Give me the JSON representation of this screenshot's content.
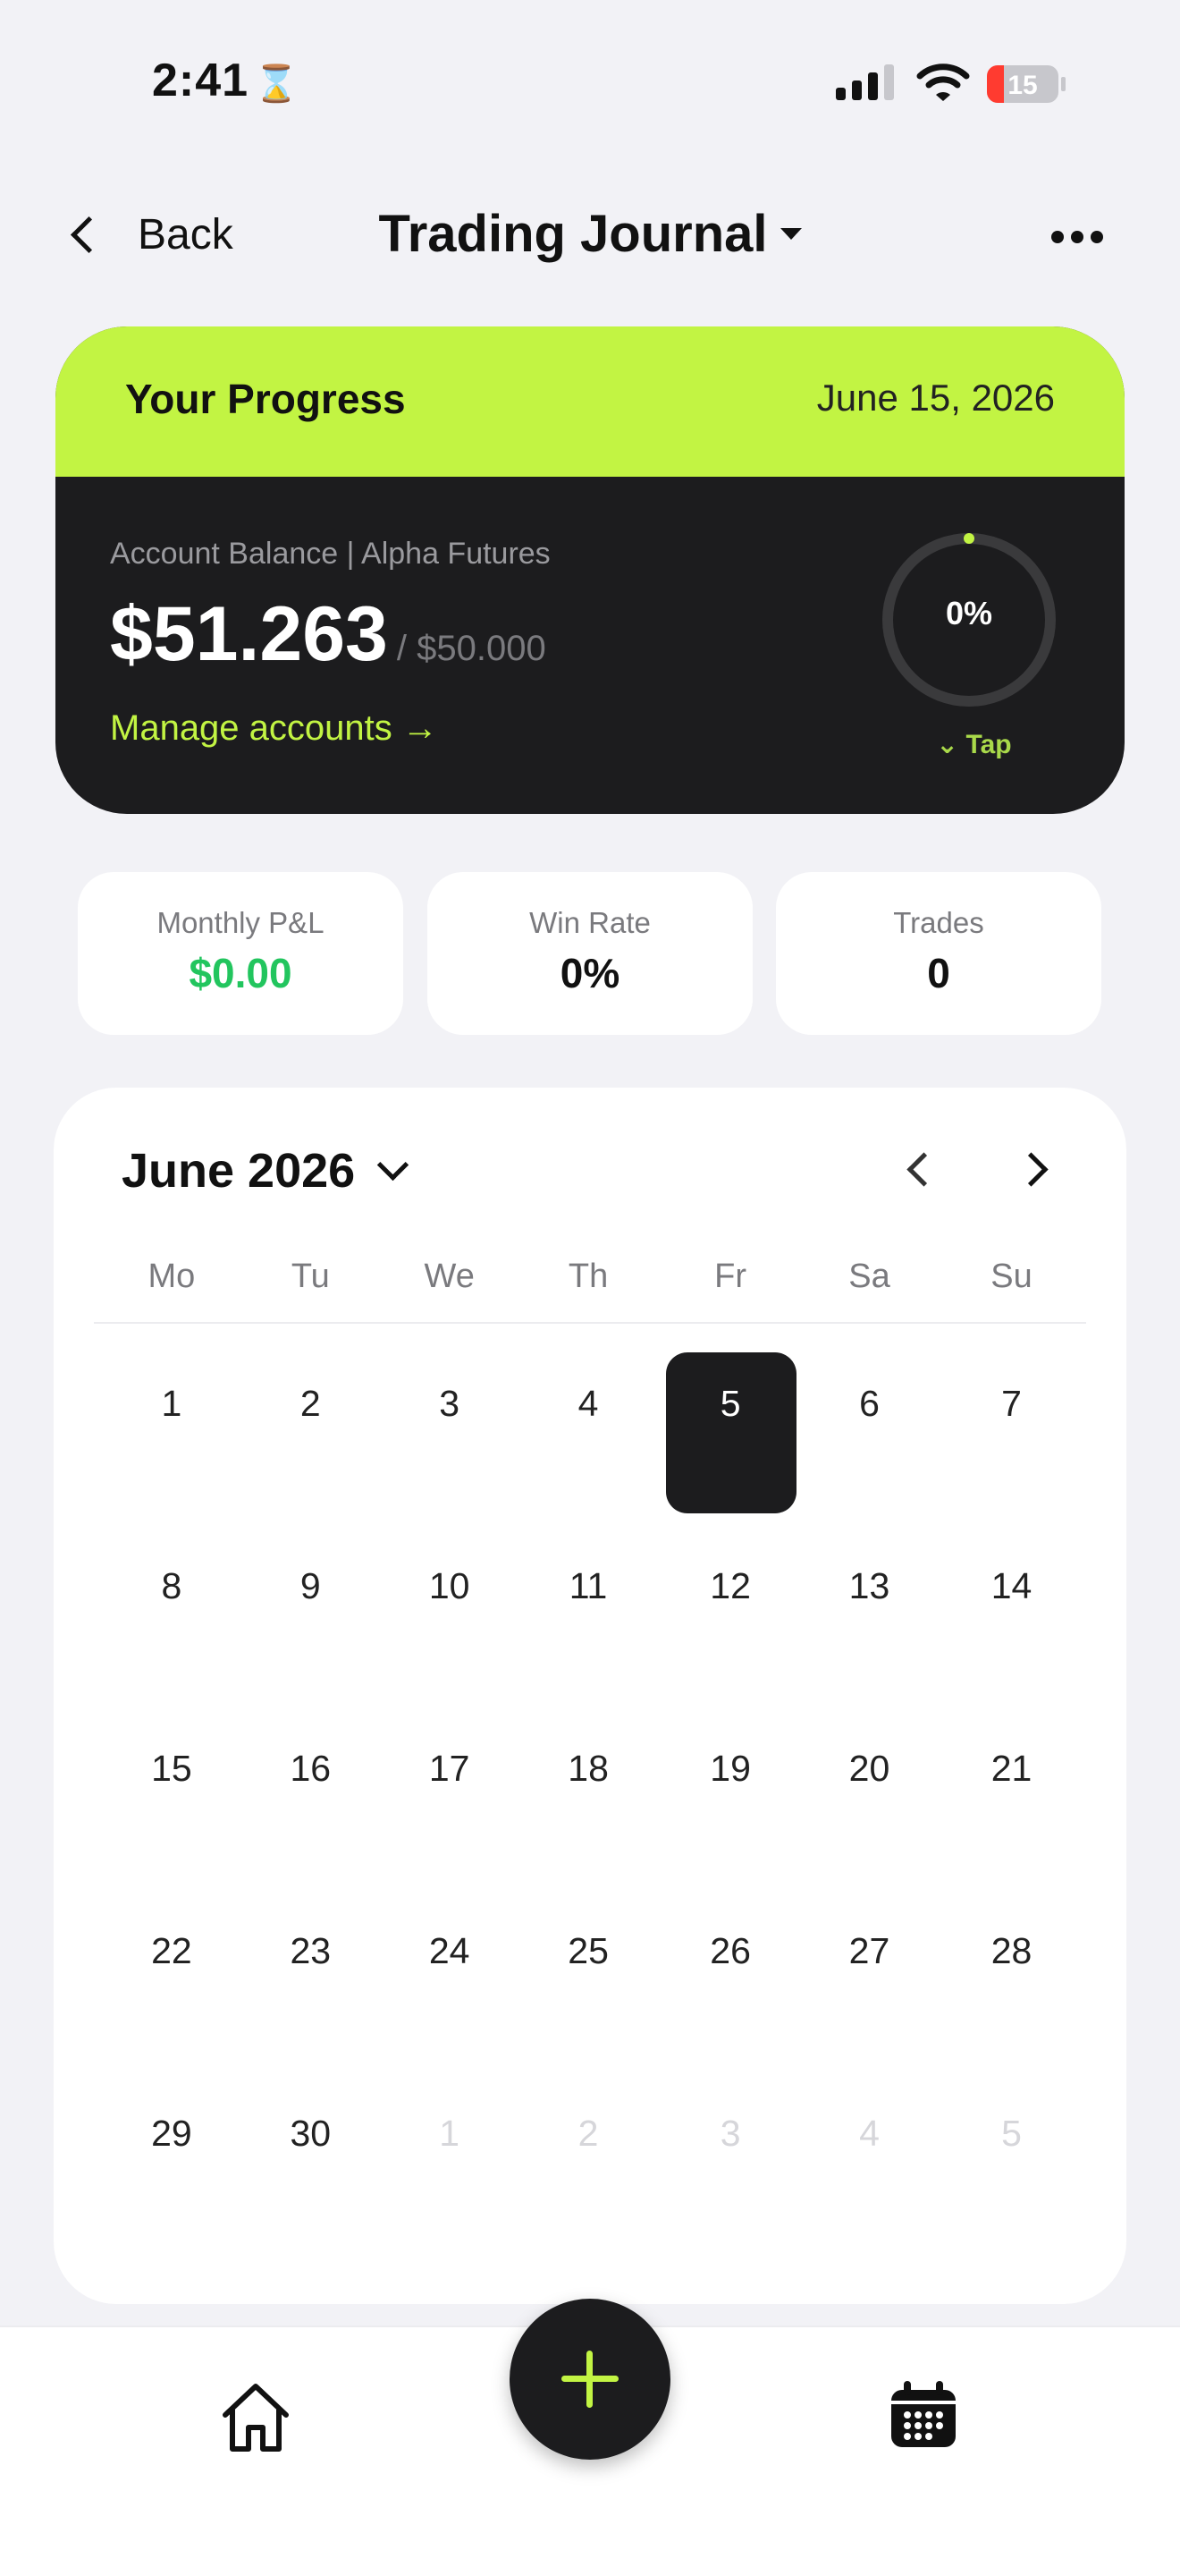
{
  "status_bar": {
    "time": "2:41",
    "battery": "15"
  },
  "nav": {
    "back_label": "Back",
    "title": "Trading Journal"
  },
  "progress": {
    "title": "Your Progress",
    "date": "June 15, 2026",
    "account_label": "Account Balance  | Alpha Futures",
    "balance": "$51.263",
    "target": "/ $50.000",
    "manage_label": "Manage accounts →",
    "progress_value": "0%",
    "progress_fraction": 0,
    "tap_label": "⌄ Tap"
  },
  "stats": {
    "monthly_pnl": {
      "label": "Monthly P&L",
      "value": "$0.00"
    },
    "win_rate": {
      "label": "Win Rate",
      "value": "0%"
    },
    "trades": {
      "label": "Trades",
      "value": "0"
    }
  },
  "calendar": {
    "month_label": "June 2026",
    "weekdays": [
      "Mo",
      "Tu",
      "We",
      "Th",
      "Fr",
      "Sa",
      "Su"
    ],
    "weeks": [
      [
        "1",
        "2",
        "3",
        "4",
        "5",
        "6",
        "7"
      ],
      [
        "8",
        "9",
        "10",
        "11",
        "12",
        "13",
        "14"
      ],
      [
        "15",
        "16",
        "17",
        "18",
        "19",
        "20",
        "21"
      ],
      [
        "22",
        "23",
        "24",
        "25",
        "26",
        "27",
        "28"
      ],
      [
        "29",
        "30",
        "1",
        "2",
        "3",
        "4",
        "5"
      ]
    ],
    "selected_day": "5"
  },
  "colors": {
    "accent": "#C2F443",
    "dark": "#1C1C1E",
    "positive": "#22C55E",
    "background": "#F2F2F6"
  },
  "icons": {
    "home": "home-icon",
    "calendar": "calendar-icon",
    "add": "plus-icon"
  }
}
